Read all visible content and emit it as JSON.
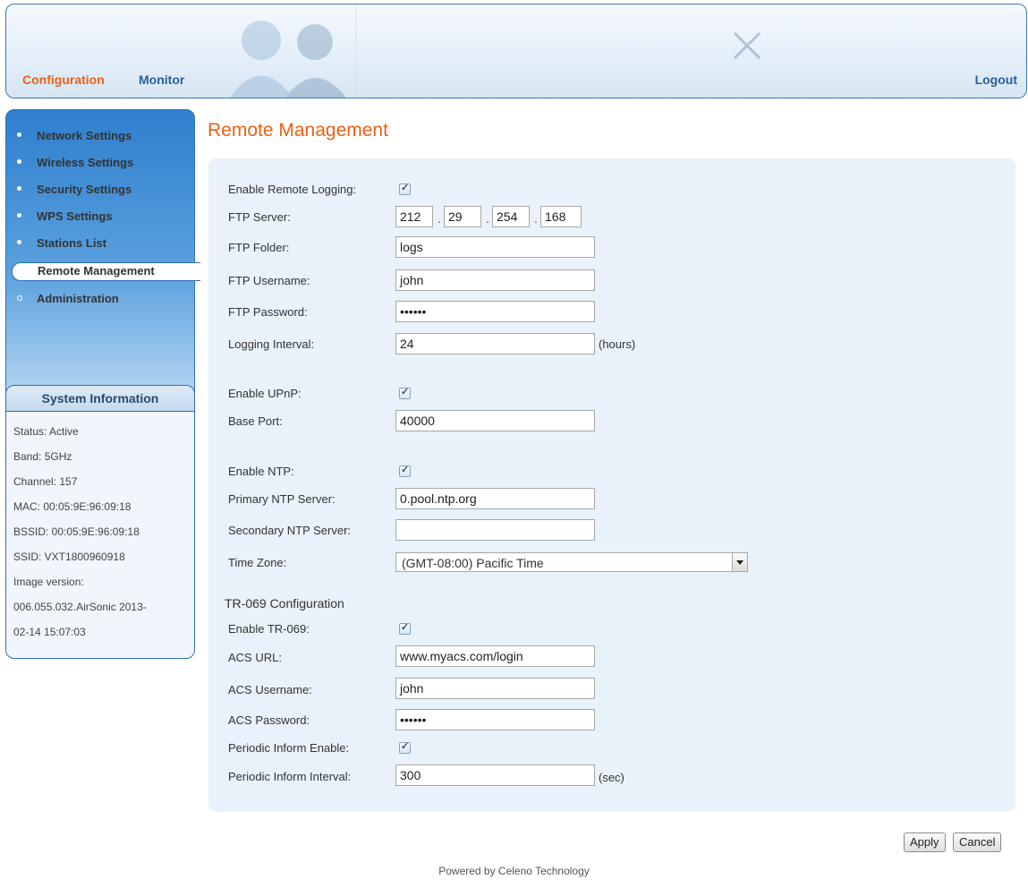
{
  "header": {
    "nav": {
      "configuration": "Configuration",
      "monitor": "Monitor",
      "logout": "Logout"
    }
  },
  "sidebar": {
    "items": [
      {
        "label": "Network Settings"
      },
      {
        "label": "Wireless Settings"
      },
      {
        "label": "Security Settings"
      },
      {
        "label": "WPS Settings"
      },
      {
        "label": "Stations List"
      },
      {
        "label": "Remote Management"
      },
      {
        "label": "Administration"
      }
    ],
    "active_index": 5,
    "system_info": {
      "title": "System Information",
      "lines": [
        "Status: Active",
        "Band: 5GHz",
        "Channel: 157",
        "MAC: 00:05:9E:96:09:18",
        "BSSID: 00:05:9E:96:09:18",
        "SSID: VXT1800960918",
        "Image version:",
        "006.055.032.AirSonic 2013-",
        "02-14 15:07:03"
      ]
    }
  },
  "main": {
    "title": "Remote Management",
    "form": {
      "enable_remote_logging": {
        "label": "Enable Remote Logging:",
        "checked": true
      },
      "ftp_server": {
        "label": "FTP Server:",
        "octets": [
          "212",
          "29",
          "254",
          "168"
        ]
      },
      "ftp_folder": {
        "label": "FTP Folder:",
        "value": "logs"
      },
      "ftp_username": {
        "label": "FTP Username:",
        "value": "john"
      },
      "ftp_password": {
        "label": "FTP Password:",
        "value": "••••••"
      },
      "logging_interval": {
        "label": "Logging Interval:",
        "value": "24",
        "unit": "(hours)"
      },
      "enable_upnp": {
        "label": "Enable UPnP:",
        "checked": true
      },
      "base_port": {
        "label": "Base Port:",
        "value": "40000"
      },
      "enable_ntp": {
        "label": "Enable NTP:",
        "checked": true
      },
      "primary_ntp": {
        "label": "Primary NTP Server:",
        "value": "0.pool.ntp.org"
      },
      "secondary_ntp": {
        "label": "Secondary NTP Server:",
        "value": ""
      },
      "time_zone": {
        "label": "Time Zone:",
        "value": "(GMT-08:00) Pacific Time"
      },
      "tr069_heading": "TR-069 Configuration",
      "enable_tr069": {
        "label": "Enable TR-069:",
        "checked": true
      },
      "acs_url": {
        "label": "ACS URL:",
        "value": "www.myacs.com/login"
      },
      "acs_username": {
        "label": "ACS Username:",
        "value": "john"
      },
      "acs_password": {
        "label": "ACS Password:",
        "value": "••••••"
      },
      "periodic_inform_enable": {
        "label": "Periodic Inform Enable:",
        "checked": true
      },
      "periodic_inform_interval": {
        "label": "Periodic Inform Interval:",
        "value": "300",
        "unit": "(sec)"
      }
    },
    "buttons": {
      "apply": "Apply",
      "cancel": "Cancel"
    }
  },
  "footer": {
    "text": "Powered by Celeno Technology"
  },
  "colors": {
    "accent": "#e8611a",
    "nav_blue": "#2a5d9f",
    "menu_blue": "#2f7fcd",
    "panel_bg": "#e9f2fa"
  }
}
